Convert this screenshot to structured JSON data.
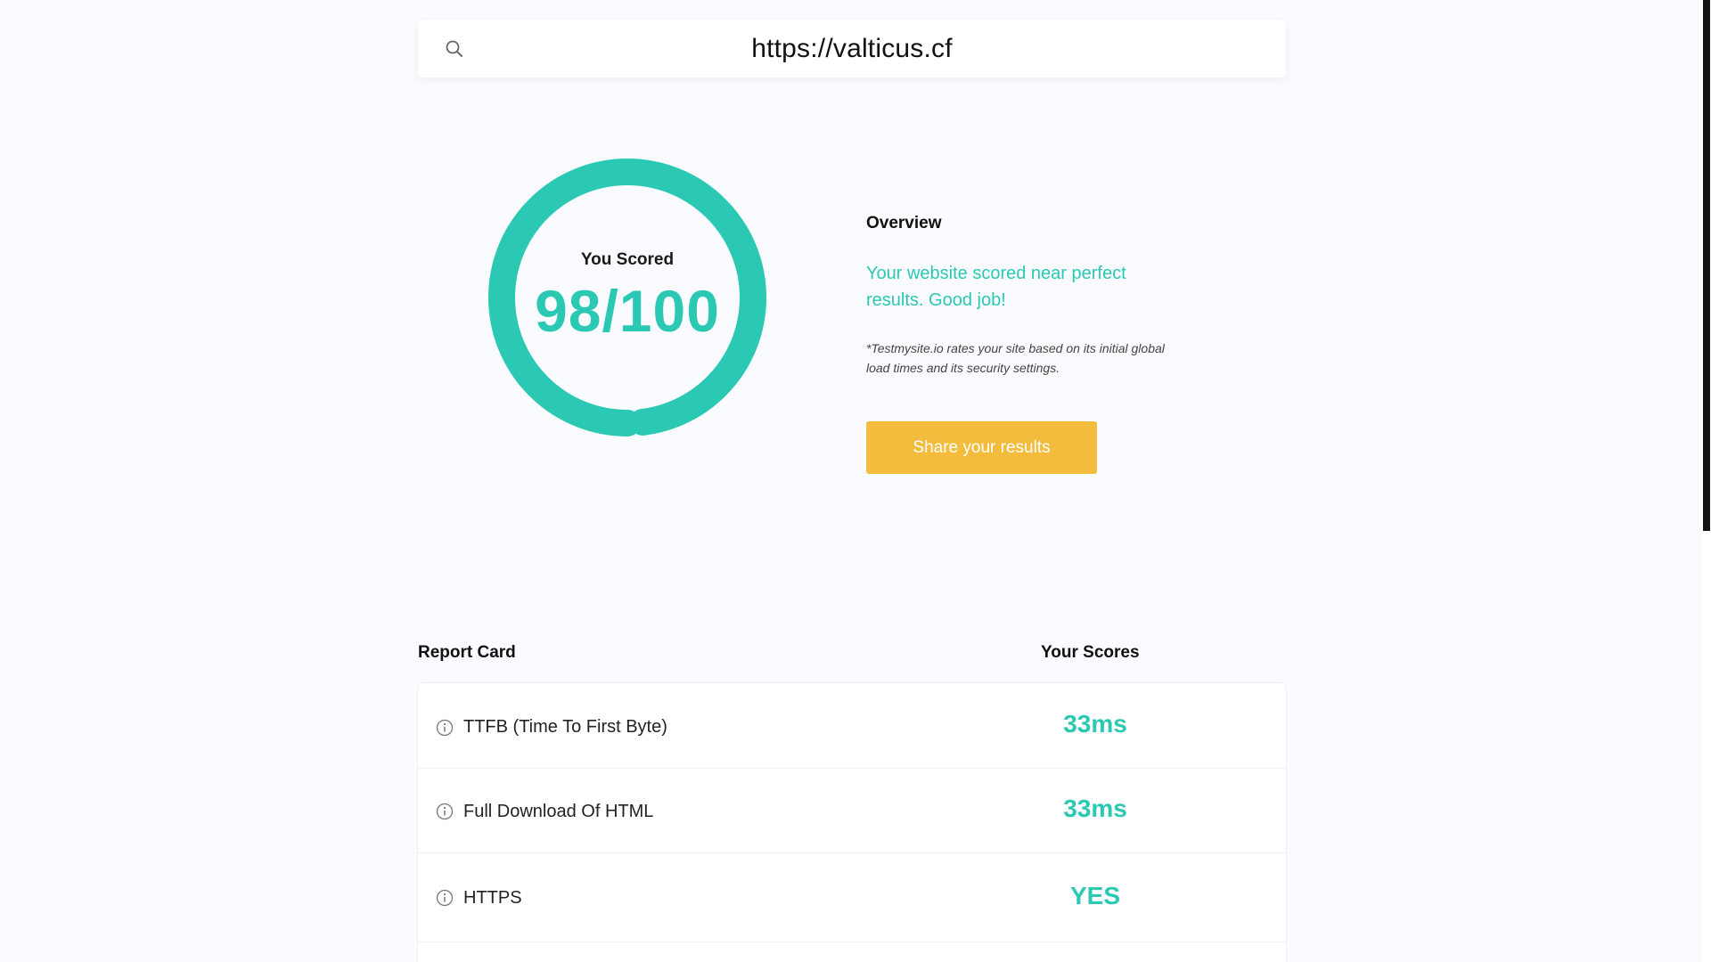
{
  "search": {
    "url": "https://valticus.cf",
    "icon": "search-icon"
  },
  "score": {
    "caption": "You Scored",
    "value_text": "98/100",
    "value": 98,
    "max": 100,
    "ring_color": "#2bc8b4"
  },
  "overview": {
    "title": "Overview",
    "message": "Your website scored near perfect results. Good job!",
    "note": "*Testmysite.io rates your site based on its initial global load times and its security settings.",
    "share_label": "Share your results",
    "share_color": "#f3bc3c"
  },
  "report": {
    "header_left": "Report Card",
    "header_right": "Your Scores",
    "rows": [
      {
        "label": "TTFB (Time To First Byte)",
        "value": "33ms",
        "icon": "info-icon"
      },
      {
        "label": "Full Download Of HTML",
        "value": "33ms",
        "icon": "info-icon"
      },
      {
        "label": "HTTPS",
        "value": "YES",
        "icon": "info-icon"
      }
    ]
  },
  "colors": {
    "accent": "#2bc8b4",
    "button": "#f3bc3c",
    "background": "#fafbfe"
  }
}
